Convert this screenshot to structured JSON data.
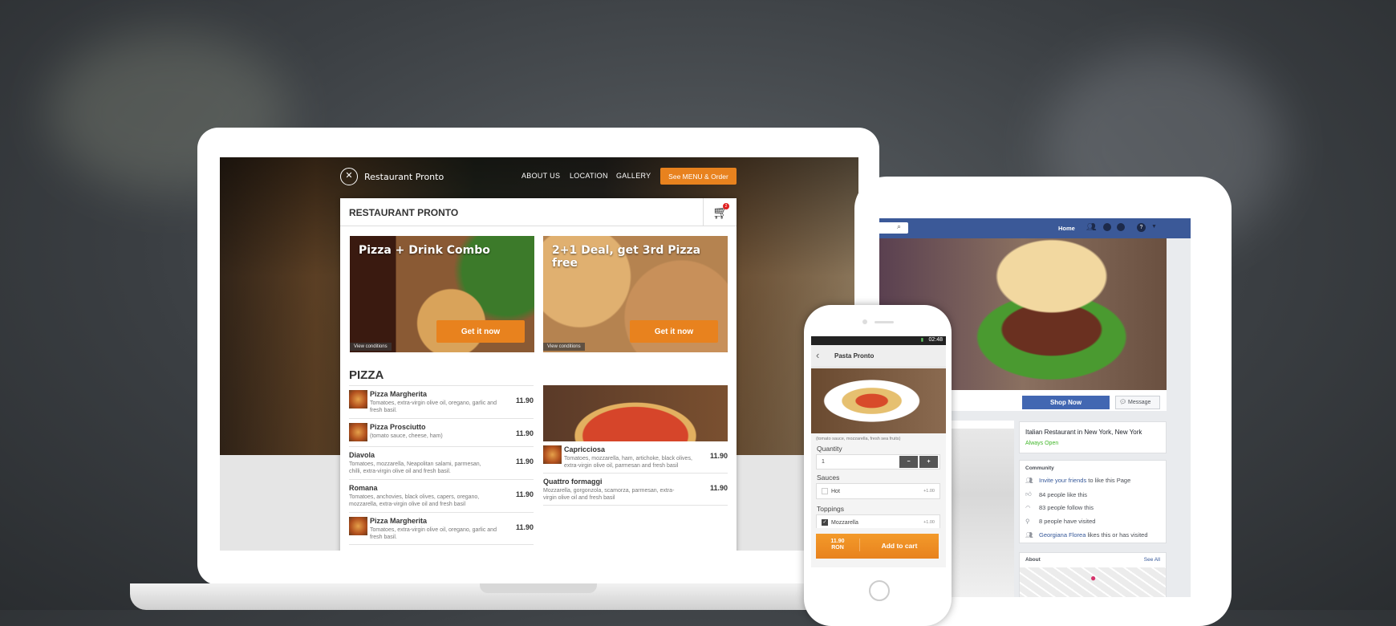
{
  "laptop": {
    "brand": "Restaurant Pronto",
    "nav": [
      "ABOUT US",
      "LOCATION",
      "GALLERY"
    ],
    "cta": "See MENU & Order",
    "card_title": "RESTAURANT PRONTO",
    "cart_count": "2",
    "promos": [
      {
        "title": "Pizza + Drink Combo",
        "button": "Get it now",
        "conditions": "View conditions"
      },
      {
        "title": "2+1 Deal, get 3rd Pizza free",
        "button": "Get it now",
        "conditions": "View conditions"
      }
    ],
    "section": "PIZZA",
    "left_items": [
      {
        "name": "Pizza Margherita",
        "desc": "Tomatoes, extra-virgin olive oil, oregano, garlic and fresh basil.",
        "price": "11.90"
      },
      {
        "name": "Pizza Prosciutto",
        "desc": "(tomato sauce, cheese, ham)",
        "price": "11.90"
      },
      {
        "name": "Diavola",
        "desc": "Tomatoes, mozzarella, Neapolitan salami, parmesan, chilli, extra-virgin olive oil and fresh basil.",
        "price": "11.90"
      },
      {
        "name": "Romana",
        "desc": "Tomatoes, anchovies, black olives, capers, oregano, mozzarella, extra-virgin olive oil and fresh basil",
        "price": "11.90"
      },
      {
        "name": "Pizza Margherita",
        "desc": "Tomatoes, extra-virgin olive oil, oregano, garlic and fresh basil.",
        "price": "11.90"
      }
    ],
    "right_items": [
      {
        "name": "Capricciosa",
        "desc": "Tomatoes, mozzarella, ham, artichoke, black olives, extra-virgin olive oil, parmesan and fresh basil",
        "price": "11.90"
      },
      {
        "name": "Quattro formaggi",
        "desc": "Mozzarella, gorgonzola, scamorza, parmesan, extra-virgin olive oil and fresh basil",
        "price": "11.90"
      }
    ]
  },
  "tablet": {
    "home": "Home",
    "shop_now": "Shop Now",
    "message": "Message",
    "info_title": "Italian Restaurant in New York, New York",
    "open": "Always Open",
    "community": "Community",
    "invite_link": "Invite your friends",
    "invite_rest": "to like this Page",
    "likes": "84 people like this",
    "follows": "83 people follow this",
    "visited": "8 people have visited",
    "friend_link": "Georgiana Florea",
    "friend_rest": "likes this or has visited",
    "about": "About",
    "see_all": "See All",
    "colors": {
      "fb_blue": "#3b5998",
      "open_green": "#42b72a"
    }
  },
  "phone": {
    "time": "02:48",
    "title": "Pasta Pronto",
    "desc": "(tomato sauce, mozzarella, fresh sea fruits)",
    "quantity_label": "Quantity",
    "quantity": "1",
    "sauces_label": "Sauces",
    "sauce": "Hot",
    "sauce_price": "+1.00",
    "toppings_label": "Toppings",
    "topping": "Mozzarella",
    "topping_price": "+1.00",
    "price": "11.90",
    "currency": "RON",
    "add": "Add to cart",
    "accent": "#e8821e"
  }
}
